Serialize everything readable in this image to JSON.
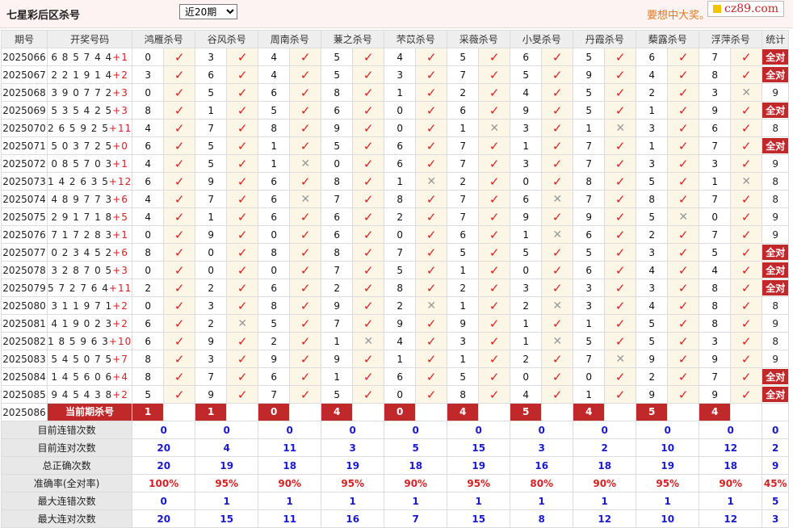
{
  "header": {
    "title": "七星彩后区杀号",
    "period_select": "近20期",
    "slogan": "要想中大奖。",
    "logo": "cz89.com"
  },
  "columns": {
    "period": "期号",
    "draw": "开奖号码",
    "stat": "统计",
    "experts": [
      "鸿雁杀号",
      "谷风杀号",
      "周南杀号",
      "蒹之杀号",
      "芣苡杀号",
      "采薇杀号",
      "小旻杀号",
      "丹霞杀号",
      "蔾露杀号",
      "浮萍杀号"
    ]
  },
  "rows": [
    {
      "period": "2025066",
      "nums": "6 8 5 7 4 4",
      "sum": "+1",
      "kills": [
        "0",
        "3",
        "4",
        "5",
        "4",
        "5",
        "6",
        "5",
        "6",
        "7"
      ],
      "marks": [
        1,
        1,
        1,
        1,
        1,
        1,
        1,
        1,
        1,
        1
      ],
      "stat": "全对",
      "all": true
    },
    {
      "period": "2025067",
      "nums": "2 2 1 9 1 4",
      "sum": "+2",
      "kills": [
        "3",
        "6",
        "4",
        "5",
        "3",
        "7",
        "5",
        "9",
        "4",
        "8"
      ],
      "marks": [
        1,
        1,
        1,
        1,
        1,
        1,
        1,
        1,
        1,
        1
      ],
      "stat": "全对",
      "all": true
    },
    {
      "period": "2025068",
      "nums": "3 9 0 7 7 2",
      "sum": "+3",
      "kills": [
        "0",
        "5",
        "6",
        "8",
        "1",
        "2",
        "4",
        "5",
        "2",
        "3"
      ],
      "marks": [
        1,
        1,
        1,
        1,
        1,
        1,
        1,
        1,
        1,
        0
      ],
      "stat": "9",
      "all": false
    },
    {
      "period": "2025069",
      "nums": "5 3 5 4 2 5",
      "sum": "+3",
      "kills": [
        "8",
        "1",
        "5",
        "6",
        "0",
        "6",
        "9",
        "5",
        "1",
        "9"
      ],
      "marks": [
        1,
        1,
        1,
        1,
        1,
        1,
        1,
        1,
        1,
        1
      ],
      "stat": "全对",
      "all": true
    },
    {
      "period": "2025070",
      "nums": "2 6 5 9 2 5",
      "sum": "+11",
      "kills": [
        "4",
        "7",
        "8",
        "9",
        "0",
        "1",
        "3",
        "1",
        "3",
        "6"
      ],
      "marks": [
        1,
        1,
        1,
        1,
        1,
        0,
        1,
        0,
        1,
        1
      ],
      "stat": "8",
      "all": false
    },
    {
      "period": "2025071",
      "nums": "5 0 3 7 2 5",
      "sum": "+0",
      "kills": [
        "6",
        "5",
        "1",
        "5",
        "6",
        "7",
        "1",
        "7",
        "1",
        "7"
      ],
      "marks": [
        1,
        1,
        1,
        1,
        1,
        1,
        1,
        1,
        1,
        1
      ],
      "stat": "全对",
      "all": true
    },
    {
      "period": "2025072",
      "nums": "0 8 5 7 0 3",
      "sum": "+1",
      "kills": [
        "4",
        "5",
        "1",
        "0",
        "6",
        "7",
        "3",
        "7",
        "3",
        "3"
      ],
      "marks": [
        1,
        1,
        0,
        1,
        1,
        1,
        1,
        1,
        1,
        1
      ],
      "stat": "9",
      "all": false
    },
    {
      "period": "2025073",
      "nums": "1 4 2 6 3 5",
      "sum": "+12",
      "kills": [
        "6",
        "9",
        "6",
        "8",
        "1",
        "2",
        "0",
        "8",
        "5",
        "1"
      ],
      "marks": [
        1,
        1,
        1,
        1,
        0,
        1,
        1,
        1,
        1,
        0
      ],
      "stat": "8",
      "all": false
    },
    {
      "period": "2025074",
      "nums": "4 8 9 7 7 3",
      "sum": "+6",
      "kills": [
        "4",
        "7",
        "6",
        "7",
        "8",
        "7",
        "6",
        "7",
        "8",
        "7"
      ],
      "marks": [
        1,
        1,
        0,
        1,
        1,
        1,
        0,
        1,
        1,
        1
      ],
      "stat": "8",
      "all": false
    },
    {
      "period": "2025075",
      "nums": "2 9 1 7 1 8",
      "sum": "+5",
      "kills": [
        "4",
        "1",
        "6",
        "6",
        "2",
        "7",
        "9",
        "9",
        "5",
        "0"
      ],
      "marks": [
        1,
        1,
        1,
        1,
        1,
        1,
        1,
        1,
        0,
        1
      ],
      "stat": "9",
      "all": false
    },
    {
      "period": "2025076",
      "nums": "7 1 7 2 8 3",
      "sum": "+1",
      "kills": [
        "0",
        "9",
        "0",
        "6",
        "0",
        "6",
        "1",
        "6",
        "2",
        "7"
      ],
      "marks": [
        1,
        1,
        1,
        1,
        1,
        1,
        0,
        1,
        1,
        1
      ],
      "stat": "9",
      "all": false
    },
    {
      "period": "2025077",
      "nums": "0 2 3 4 5 2",
      "sum": "+6",
      "kills": [
        "8",
        "0",
        "8",
        "8",
        "7",
        "5",
        "5",
        "5",
        "3",
        "5"
      ],
      "marks": [
        1,
        1,
        1,
        1,
        1,
        1,
        1,
        1,
        1,
        1
      ],
      "stat": "全对",
      "all": true
    },
    {
      "period": "2025078",
      "nums": "3 2 8 7 0 5",
      "sum": "+3",
      "kills": [
        "0",
        "0",
        "0",
        "7",
        "5",
        "1",
        "0",
        "6",
        "4",
        "4"
      ],
      "marks": [
        1,
        1,
        1,
        1,
        1,
        1,
        1,
        1,
        1,
        1
      ],
      "stat": "全对",
      "all": true
    },
    {
      "period": "2025079",
      "nums": "5 7 2 7 6 4",
      "sum": "+11",
      "kills": [
        "2",
        "2",
        "6",
        "2",
        "8",
        "2",
        "3",
        "3",
        "3",
        "8"
      ],
      "marks": [
        1,
        1,
        1,
        1,
        1,
        1,
        1,
        1,
        1,
        1
      ],
      "stat": "全对",
      "all": true
    },
    {
      "period": "2025080",
      "nums": "3 1 1 9 7 1",
      "sum": "+2",
      "kills": [
        "0",
        "3",
        "8",
        "9",
        "2",
        "1",
        "2",
        "3",
        "4",
        "8"
      ],
      "marks": [
        1,
        1,
        1,
        1,
        0,
        1,
        0,
        1,
        1,
        1
      ],
      "stat": "8",
      "all": false
    },
    {
      "period": "2025081",
      "nums": "4 1 9 0 2 3",
      "sum": "+2",
      "kills": [
        "6",
        "2",
        "5",
        "7",
        "9",
        "9",
        "1",
        "1",
        "5",
        "8"
      ],
      "marks": [
        1,
        0,
        1,
        1,
        1,
        1,
        1,
        1,
        1,
        1
      ],
      "stat": "9",
      "all": false
    },
    {
      "period": "2025082",
      "nums": "1 8 5 9 6 3",
      "sum": "+10",
      "kills": [
        "6",
        "9",
        "2",
        "1",
        "4",
        "3",
        "1",
        "5",
        "5",
        "3"
      ],
      "marks": [
        1,
        1,
        1,
        0,
        1,
        1,
        0,
        1,
        1,
        1
      ],
      "stat": "8",
      "all": false
    },
    {
      "period": "2025083",
      "nums": "5 4 5 0 7 5",
      "sum": "+7",
      "kills": [
        "8",
        "3",
        "9",
        "9",
        "1",
        "1",
        "2",
        "7",
        "9",
        "9"
      ],
      "marks": [
        1,
        1,
        1,
        1,
        1,
        1,
        1,
        0,
        1,
        1
      ],
      "stat": "9",
      "all": false
    },
    {
      "period": "2025084",
      "nums": "1 4 5 6 0 6",
      "sum": "+4",
      "kills": [
        "8",
        "7",
        "6",
        "1",
        "6",
        "5",
        "0",
        "0",
        "2",
        "7"
      ],
      "marks": [
        1,
        1,
        1,
        1,
        1,
        1,
        1,
        1,
        1,
        1
      ],
      "stat": "全对",
      "all": true
    },
    {
      "period": "2025085",
      "nums": "9 4 5 4 3 8",
      "sum": "+2",
      "kills": [
        "5",
        "9",
        "7",
        "5",
        "0",
        "8",
        "4",
        "1",
        "9",
        "9"
      ],
      "marks": [
        1,
        1,
        1,
        1,
        1,
        1,
        1,
        1,
        1,
        1
      ],
      "stat": "全对",
      "all": true
    }
  ],
  "current": {
    "period": "2025086",
    "label": "当前期杀号",
    "kills": [
      "1",
      "1",
      "0",
      "4",
      "0",
      "4",
      "5",
      "4",
      "5",
      "4"
    ]
  },
  "summary": [
    {
      "label": "目前连错次数",
      "values": [
        "0",
        "0",
        "0",
        "0",
        "0",
        "0",
        "0",
        "0",
        "0",
        "0",
        "0"
      ],
      "red": false
    },
    {
      "label": "目前连对次数",
      "values": [
        "20",
        "4",
        "11",
        "3",
        "5",
        "15",
        "3",
        "2",
        "10",
        "12",
        "2"
      ],
      "red": false
    },
    {
      "label": "总正确次数",
      "values": [
        "20",
        "19",
        "18",
        "19",
        "18",
        "19",
        "16",
        "18",
        "19",
        "18",
        "9"
      ],
      "red": false
    },
    {
      "label": "准确率(全对率)",
      "values": [
        "100%",
        "95%",
        "90%",
        "95%",
        "90%",
        "95%",
        "80%",
        "90%",
        "95%",
        "90%",
        "45%"
      ],
      "red": true
    },
    {
      "label": "最大连错次数",
      "values": [
        "0",
        "1",
        "1",
        "1",
        "1",
        "1",
        "1",
        "1",
        "1",
        "1",
        "5"
      ],
      "red": false
    },
    {
      "label": "最大连对次数",
      "values": [
        "20",
        "15",
        "11",
        "16",
        "7",
        "15",
        "8",
        "12",
        "10",
        "12",
        "3"
      ],
      "red": false
    }
  ]
}
